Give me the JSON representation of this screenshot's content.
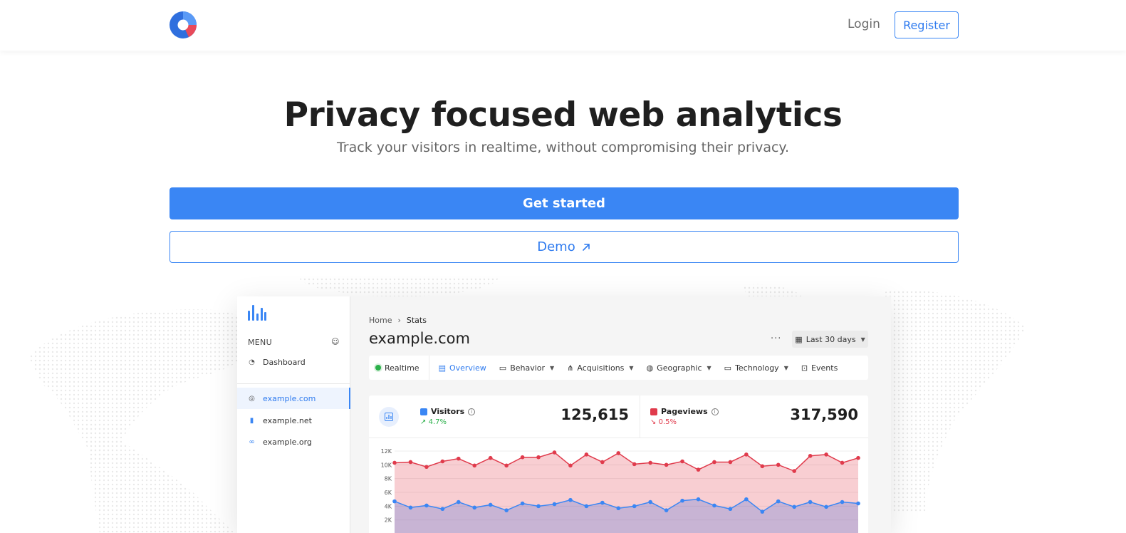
{
  "nav": {
    "login": "Login",
    "register": "Register"
  },
  "hero": {
    "title": "Privacy focused web analytics",
    "subtitle": "Track your visitors in realtime, without compromising their privacy.",
    "cta_primary": "Get started",
    "cta_secondary": "Demo"
  },
  "dashboard": {
    "sidebar": {
      "menu_label": "MENU",
      "items": [
        {
          "label": "Dashboard",
          "icon": "dashboard-icon"
        },
        {
          "label": "example.com",
          "icon": "globe-icon",
          "active": true
        },
        {
          "label": "example.net",
          "icon": "bar-chart-icon"
        },
        {
          "label": "example.org",
          "icon": "link-icon"
        }
      ]
    },
    "breadcrumb": {
      "home": "Home",
      "current": "Stats"
    },
    "site_title": "example.com",
    "date_range": "Last 30 days",
    "tabs": [
      {
        "label": "Realtime"
      },
      {
        "label": "Overview",
        "active": true
      },
      {
        "label": "Behavior"
      },
      {
        "label": "Acquisitions"
      },
      {
        "label": "Geographic"
      },
      {
        "label": "Technology"
      },
      {
        "label": "Events"
      }
    ],
    "stats": {
      "visitors": {
        "label": "Visitors",
        "change": "4.7%",
        "value": "125,615",
        "color": "#3a86f4"
      },
      "pageviews": {
        "label": "Pageviews",
        "change": "0.5%",
        "value": "317,590",
        "color": "#e03b4c"
      }
    }
  },
  "colors": {
    "accent": "#3a86f4",
    "pageviews": "#e03b4c",
    "visitors": "#3a86f4",
    "positive": "#2bb04a"
  },
  "chart_data": {
    "type": "area",
    "yticks": [
      "12K",
      "10K",
      "8K",
      "6K",
      "4K",
      "2K"
    ],
    "ylim": [
      0,
      12000
    ],
    "series": [
      {
        "name": "Pageviews",
        "values": [
          10300,
          10400,
          9700,
          10500,
          10900,
          9900,
          11000,
          9900,
          11100,
          11100,
          11800,
          9900,
          11500,
          10400,
          11700,
          10100,
          10300,
          10000,
          10500,
          9300,
          10400,
          10400,
          11500,
          9800,
          10000,
          9100,
          11300,
          11500,
          10300,
          11000
        ]
      },
      {
        "name": "Visitors",
        "values": [
          4700,
          3800,
          4100,
          3600,
          4600,
          3800,
          4200,
          3400,
          4400,
          4000,
          4300,
          4900,
          4000,
          4500,
          3700,
          4000,
          4600,
          3400,
          4800,
          5000,
          4100,
          3600,
          5000,
          3200,
          4700,
          3900,
          4600,
          3900,
          4600,
          4400
        ]
      }
    ]
  }
}
